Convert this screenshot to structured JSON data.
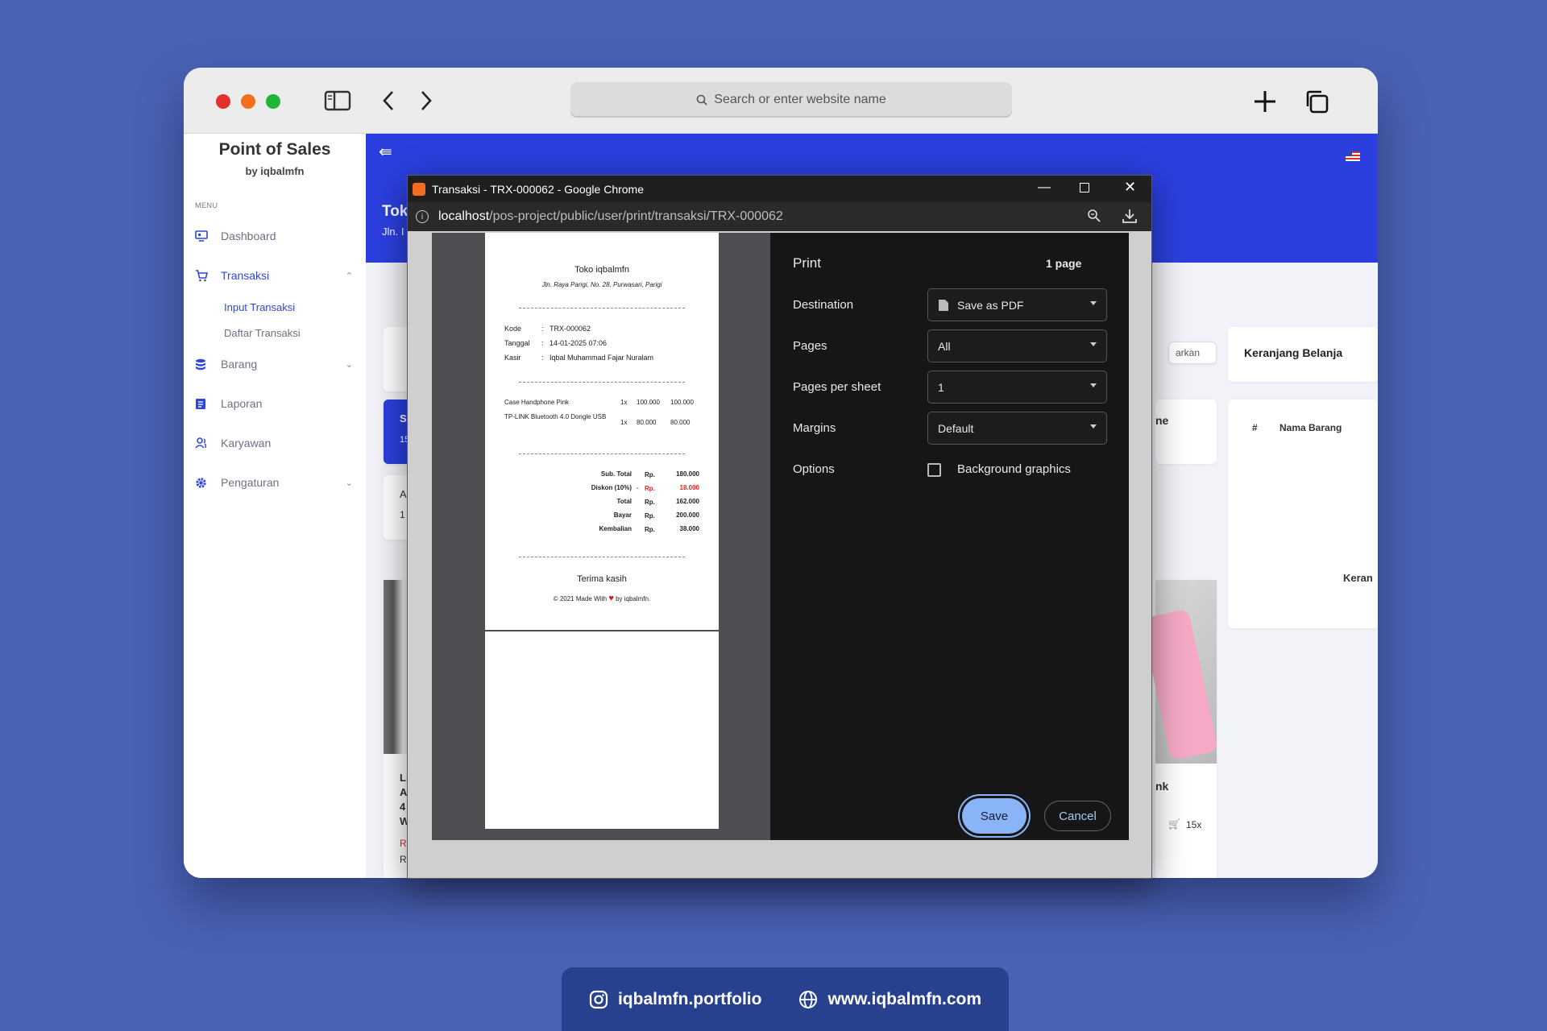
{
  "search": {
    "placeholder": "Search or enter website name"
  },
  "app": {
    "brand_title": "Point of Sales",
    "brand_sub": "by iqbalmfn",
    "menu_label": "MENU",
    "nav": {
      "dashboard": "Dashboard",
      "transaksi": "Transaksi",
      "input_transaksi": "Input Transaksi",
      "daftar_transaksi": "Daftar Transaksi",
      "barang": "Barang",
      "laporan": "Laporan",
      "karyawan": "Karyawan",
      "pengaturan": "Pengaturan"
    },
    "header_frag1": "Tok",
    "header_frag2": "Jln. I",
    "sort_frag": "arkan",
    "cart_title": "Keranjang Belanja",
    "cart_col_no": "#",
    "cart_col_name": "Nama Barang",
    "cart_frag": "Keran",
    "card_frag_ne": "ne",
    "card_frag_nk": "nk",
    "stock_frag": "15x",
    "left_frags": [
      "S",
      "15",
      "A",
      "1",
      "Li",
      "A",
      "4",
      "W",
      "R",
      "R"
    ]
  },
  "popup": {
    "title": "Transaksi - TRX-000062 - Google Chrome",
    "url_host": "localhost",
    "url_path": "/pos-project/public/user/print/transaksi/TRX-000062"
  },
  "receipt": {
    "store": "Toko iqbalmfn",
    "address": "Jln. Raya Parigi, No. 28, Purwasari, Parigi",
    "kode_label": "Kode",
    "kode": "TRX-000062",
    "tanggal_label": "Tanggal",
    "tanggal": "14-01-2025 07:06",
    "kasir_label": "Kasir",
    "kasir": "Iqbal Muhammad Fajar Nuralam",
    "items": [
      {
        "name": "Case Handphone Pink",
        "qty": "1x",
        "price": "100.000",
        "total": "100.000"
      },
      {
        "name": "TP-LINK Bluetooth 4.0 Dongle USB",
        "qty": "1x",
        "price": "80.000",
        "total": "80.000"
      }
    ],
    "rp": "Rp.",
    "subtotal_label": "Sub. Total",
    "subtotal": "180.000",
    "diskon_label": "Diskon (10%)",
    "diskon_sign": "-",
    "diskon": "18.000",
    "total_label": "Total",
    "total": "162.000",
    "bayar_label": "Bayar",
    "bayar": "200.000",
    "kembalian_label": "Kembalian",
    "kembalian": "38.000",
    "thanks": "Terima kasih",
    "footer_pre": "© 2021 Made With",
    "footer_post": "by iqbalmfn."
  },
  "print": {
    "heading": "Print",
    "pages_count": "1 page",
    "destination_label": "Destination",
    "destination_value": "Save as PDF",
    "pages_label": "Pages",
    "pages_value": "All",
    "per_sheet_label": "Pages per sheet",
    "per_sheet_value": "1",
    "margins_label": "Margins",
    "margins_value": "Default",
    "options_label": "Options",
    "bg_graphics_label": "Background graphics",
    "save": "Save",
    "cancel": "Cancel"
  },
  "footer": {
    "instagram": "iqbalmfn.portfolio",
    "website": "www.iqbalmfn.com"
  },
  "colors": {
    "brand_blue": "#2b3fde",
    "print_accent": "#8ab4f8",
    "discount_red": "#e02424"
  }
}
